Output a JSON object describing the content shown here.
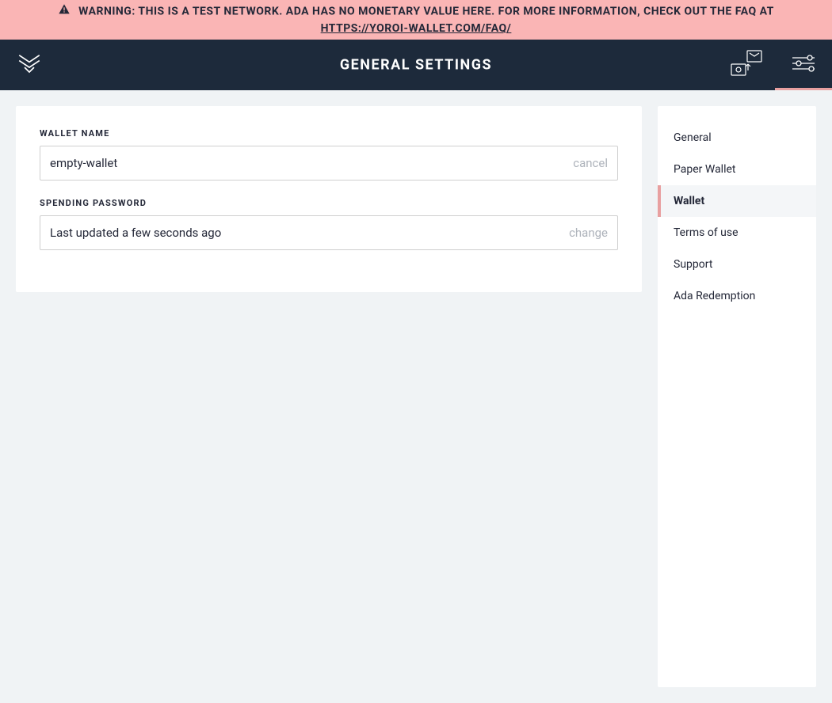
{
  "banner": {
    "warning_text": "WARNING: THIS IS A TEST NETWORK. ADA HAS NO MONETARY VALUE HERE. FOR MORE INFORMATION, CHECK OUT THE FAQ AT ",
    "link_text": "HTTPS://YOROI-WALLET.COM/FAQ/"
  },
  "topbar": {
    "title": "GENERAL SETTINGS"
  },
  "wallet_name": {
    "label": "WALLET NAME",
    "value": "empty-wallet",
    "action": "cancel"
  },
  "spending_password": {
    "label": "SPENDING PASSWORD",
    "status": "Last updated a few seconds ago",
    "action": "change"
  },
  "sidebar": {
    "items": [
      {
        "label": "General",
        "active": false
      },
      {
        "label": "Paper Wallet",
        "active": false
      },
      {
        "label": "Wallet",
        "active": true
      },
      {
        "label": "Terms of use",
        "active": false
      },
      {
        "label": "Support",
        "active": false
      },
      {
        "label": "Ada Redemption",
        "active": false
      }
    ]
  }
}
